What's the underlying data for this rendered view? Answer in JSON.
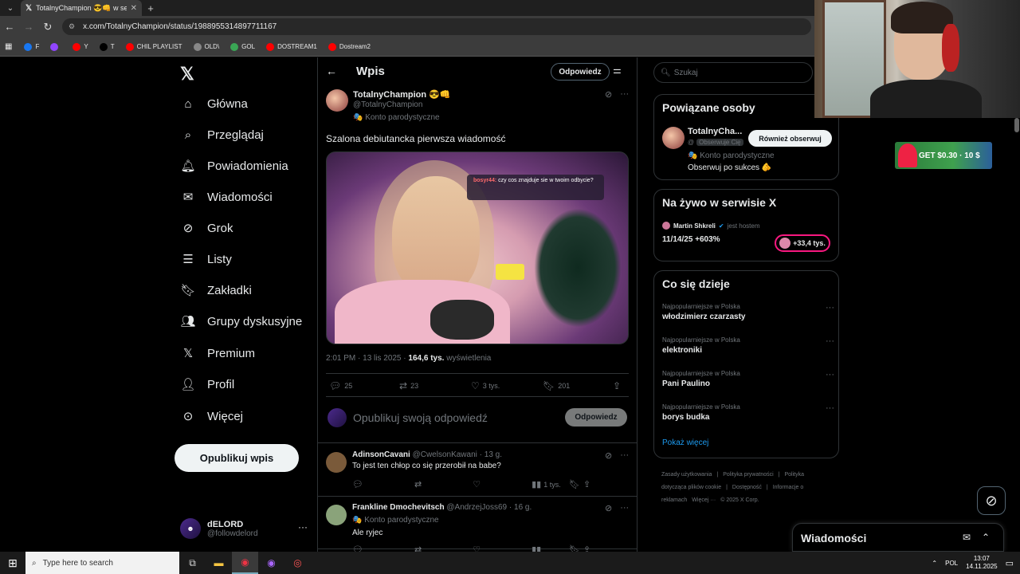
{
  "browser": {
    "tab_title": "TotalnyChampion 😎👊 w serw",
    "url": "x.com/TotalnyChampion/status/1988955314897711167",
    "bookmarks": [
      {
        "label": "F",
        "icon": "facebook-icon",
        "color": "#1877f2"
      },
      {
        "label": "",
        "icon": "twitch-icon",
        "color": "#9146ff"
      },
      {
        "label": "Y",
        "icon": "youtube-icon",
        "color": "#ff0000"
      },
      {
        "label": "T",
        "icon": "x-icon",
        "color": "#000000"
      },
      {
        "label": "CHIL PLAYLIST",
        "icon": "youtube-icon",
        "color": "#ff0000"
      },
      {
        "label": "OLD\\",
        "icon": "folder-icon",
        "color": "#888888"
      },
      {
        "label": "GOL",
        "icon": "gol-icon",
        "color": "#3aa655"
      },
      {
        "label": "DOSTREAM1",
        "icon": "youtube-icon",
        "color": "#ff0000"
      },
      {
        "label": "Dostream2",
        "icon": "youtube-icon",
        "color": "#ff0000"
      }
    ]
  },
  "nav": {
    "items": [
      {
        "label": "Główna",
        "icon": "home-icon"
      },
      {
        "label": "Przeglądaj",
        "icon": "search-icon"
      },
      {
        "label": "Powiadomienia",
        "icon": "bell-icon"
      },
      {
        "label": "Wiadomości",
        "icon": "mail-icon"
      },
      {
        "label": "Grok",
        "icon": "grok-icon"
      },
      {
        "label": "Listy",
        "icon": "list-icon"
      },
      {
        "label": "Zakładki",
        "icon": "bookmark-icon"
      },
      {
        "label": "Grupy dyskusyjne",
        "icon": "people-icon"
      },
      {
        "label": "Premium",
        "icon": "x-icon"
      },
      {
        "label": "Profil",
        "icon": "person-icon"
      },
      {
        "label": "Więcej",
        "icon": "more-circle-icon"
      }
    ],
    "post_button": "Opublikuj wpis",
    "account": {
      "name": "dELORD",
      "handle": "@followdelord"
    }
  },
  "main": {
    "title": "Wpis",
    "reply_button": "Odpowiedz",
    "tweet": {
      "name": "TotalnyChampion 😎👊",
      "handle": "@TotalnyChampion",
      "badge": "Konto parodystyczne",
      "text": "Szalona debiutancka pierwsza wiadomość",
      "media_chat_user": "bosyr44:",
      "media_chat_text": "czy cos znajduje sie w twoim odbycie?",
      "time": "2:01 PM · 13 lis 2025 · ",
      "views": "164,6 tys.",
      "views_label": " wyświetlenia",
      "replies": "25",
      "reposts": "23",
      "likes": "3 tys.",
      "bookmarks": "201"
    },
    "compose": {
      "placeholder": "Opublikuj swoją odpowiedź",
      "button": "Odpowiedz"
    },
    "replies": [
      {
        "name": "AdinsonCavani",
        "handle": "@CwelsonKawani · 13 g.",
        "badge": "",
        "text": "To jest ten chłop co się przerobił na babe?",
        "views": "1 tys.",
        "avatar_color": "#7a5a3a"
      },
      {
        "name": "Frankline Dmochevitsch",
        "handle": "@AndrzejJoss69 · 16 g.",
        "badge": "Konto parodystyczne",
        "text": "Ale ryjec",
        "views": "",
        "avatar_color": "#8aa37a"
      }
    ]
  },
  "right": {
    "search_placeholder": "Szukaj",
    "related": {
      "title": "Powiązane osoby",
      "name": "TotalnyCha...",
      "handle": "@",
      "follows_you": "Obserwuje Cię",
      "button": "Również obserwuj",
      "badge": "Konto parodystyczne",
      "bio": "Obserwuj po sukces 🫵"
    },
    "live": {
      "title": "Na żywo w serwisie X",
      "host_name": "Martin Shkreli",
      "host_suffix": "jest hostem",
      "space_title": "11/14/25 +603%",
      "listeners": "+33,4 tys."
    },
    "trends": {
      "title": "Co się dzieje",
      "items": [
        {
          "context": "Najpopularniejsze w Polska",
          "topic": "włodzimierz czarzasty"
        },
        {
          "context": "Najpopularniejsze w Polska",
          "topic": "elektroniki"
        },
        {
          "context": "Najpopularniejsze w Polska",
          "topic": "Pani Paulino"
        },
        {
          "context": "Najpopularniejsze w Polska",
          "topic": "borys budka"
        }
      ],
      "show_more": "Pokaż więcej"
    },
    "footer": [
      "Zasady użytkowania",
      "|",
      "Polityka prywatności",
      "|",
      "Polityka dotycząca plików cookie",
      "|",
      "Dostępność",
      "|",
      "Informacje o reklamach",
      "Więcej ···",
      "© 2025 X Corp."
    ]
  },
  "ad": {
    "text": "GET $0.30 · 10 $"
  },
  "messages_drawer": {
    "title": "Wiadomości"
  },
  "taskbar": {
    "search_placeholder": "Type here to search",
    "lang": "POL",
    "time": "13:07",
    "date": "14.11.2025"
  },
  "colors": {
    "accent": "#1d9bf0",
    "background": "#000000",
    "border": "#2f3336",
    "muted": "#71767b",
    "live": "#f91880"
  }
}
